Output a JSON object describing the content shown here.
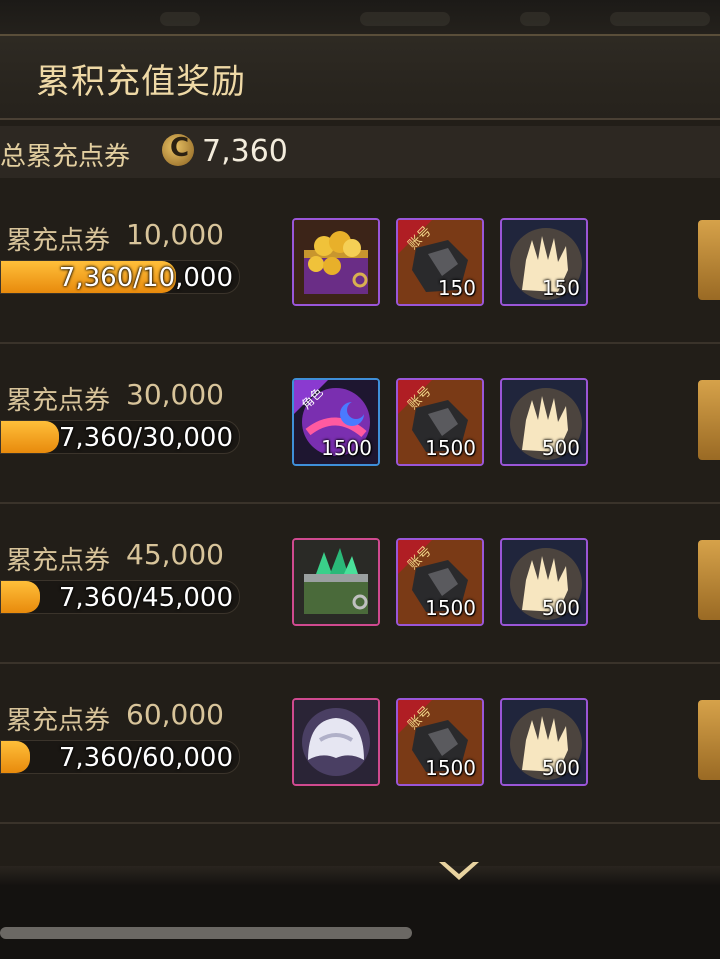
{
  "header": {
    "title": "累积充值奖励"
  },
  "total": {
    "label": "总累充点券",
    "value": "7,360"
  },
  "rows": [
    {
      "label": "累充点券",
      "amount": "10,000",
      "progress_text": "7,360/10,000",
      "progress": 0.736,
      "items": [
        {
          "icon": "treasure-chest-gold-icon",
          "qty": ""
        },
        {
          "icon": "account-ore-icon",
          "qty": "150"
        },
        {
          "icon": "glowing-glove-icon",
          "qty": "150"
        }
      ]
    },
    {
      "label": "累充点券",
      "amount": "30,000",
      "progress_text": "7,360/30,000",
      "progress": 0.245,
      "items": [
        {
          "icon": "character-orb-icon",
          "qty": "1500"
        },
        {
          "icon": "account-ore-icon",
          "qty": "1500"
        },
        {
          "icon": "glowing-glove-icon",
          "qty": "500"
        }
      ]
    },
    {
      "label": "累充点券",
      "amount": "45,000",
      "progress_text": "7,360/45,000",
      "progress": 0.164,
      "items": [
        {
          "icon": "emerald-chest-icon",
          "qty": ""
        },
        {
          "icon": "account-ore-icon",
          "qty": "1500"
        },
        {
          "icon": "glowing-glove-icon",
          "qty": "500"
        }
      ]
    },
    {
      "label": "累充点券",
      "amount": "60,000",
      "progress_text": "7,360/60,000",
      "progress": 0.123,
      "items": [
        {
          "icon": "white-helmet-icon",
          "qty": ""
        },
        {
          "icon": "account-ore-icon",
          "qty": "1500"
        },
        {
          "icon": "glowing-glove-icon",
          "qty": "500"
        }
      ]
    }
  ],
  "colors": {
    "accent": "#f0a020",
    "title": "#efd9a6",
    "panel": "#221e18"
  }
}
